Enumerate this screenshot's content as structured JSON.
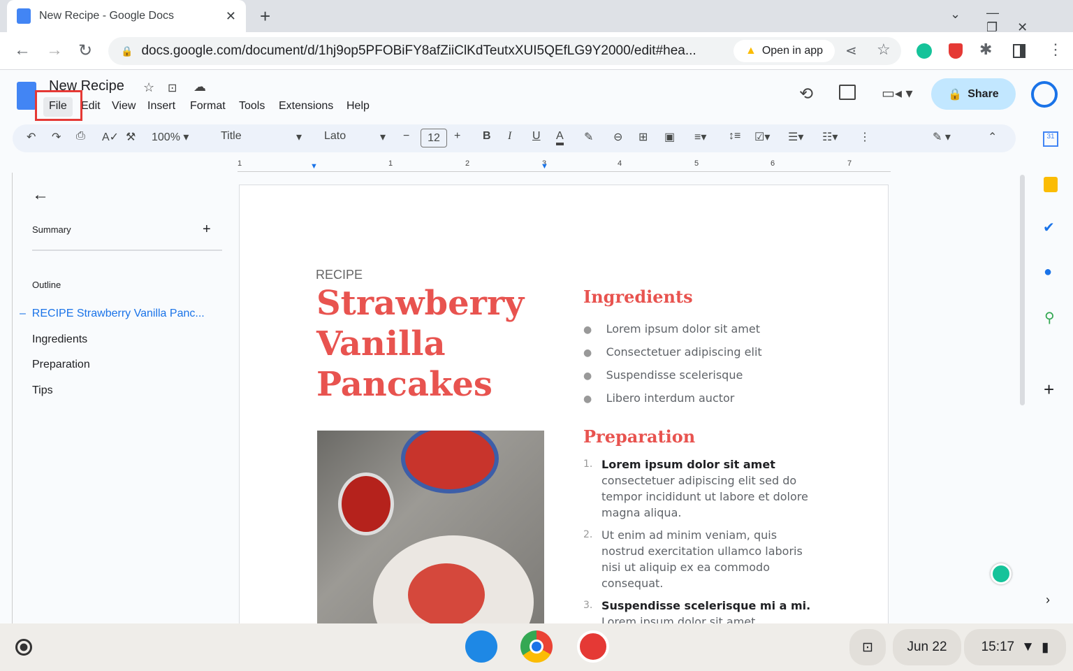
{
  "browser": {
    "tab_title": "New Recipe - Google Docs",
    "url": "docs.google.com/document/d/1hj9op5PFOBiFY8afZiiClKdTeutxXUI5QEfLG9Y2000/edit#hea...",
    "open_in_app": "Open in app"
  },
  "docs": {
    "title": "New Recipe",
    "menus": [
      "File",
      "Edit",
      "View",
      "Insert",
      "Format",
      "Tools",
      "Extensions",
      "Help"
    ],
    "share": "Share"
  },
  "toolbar": {
    "zoom": "100%",
    "style": "Title",
    "font": "Lato",
    "font_size": "12"
  },
  "ruler": [
    "1",
    "1",
    "2",
    "3",
    "4",
    "5",
    "6",
    "7"
  ],
  "outline": {
    "summary": "Summary",
    "outline": "Outline",
    "items": [
      "RECIPE Strawberry Vanilla Panc...",
      "Ingredients",
      "Preparation",
      "Tips"
    ]
  },
  "doc": {
    "label": "RECIPE",
    "title_lines": [
      "Strawberry",
      "Vanilla",
      "Pancakes"
    ],
    "ingredients_heading": "Ingredients",
    "ingredients": [
      "Lorem ipsum dolor sit amet",
      "Consectetuer adipiscing elit",
      "Suspendisse scelerisque",
      "Libero interdum auctor"
    ],
    "preparation_heading": "Preparation",
    "steps": [
      {
        "num": "1.",
        "bold": "Lorem ipsum dolor sit amet",
        "text": "consectetuer adipiscing elit sed do tempor incididunt ut labore et dolore magna aliqua."
      },
      {
        "num": "2.",
        "bold": "",
        "text": "Ut enim ad minim veniam, quis nostrud exercitation ullamco laboris nisi ut aliquip ex ea commodo consequat."
      },
      {
        "num": "3.",
        "bold": "Suspendisse scelerisque mi a mi.",
        "text": "Lorem ipsum dolor sit amet, consectetur adipiscing elit, sed dolore eiusmod"
      }
    ]
  },
  "shelf": {
    "date": "Jun 22",
    "time": "15:17"
  }
}
